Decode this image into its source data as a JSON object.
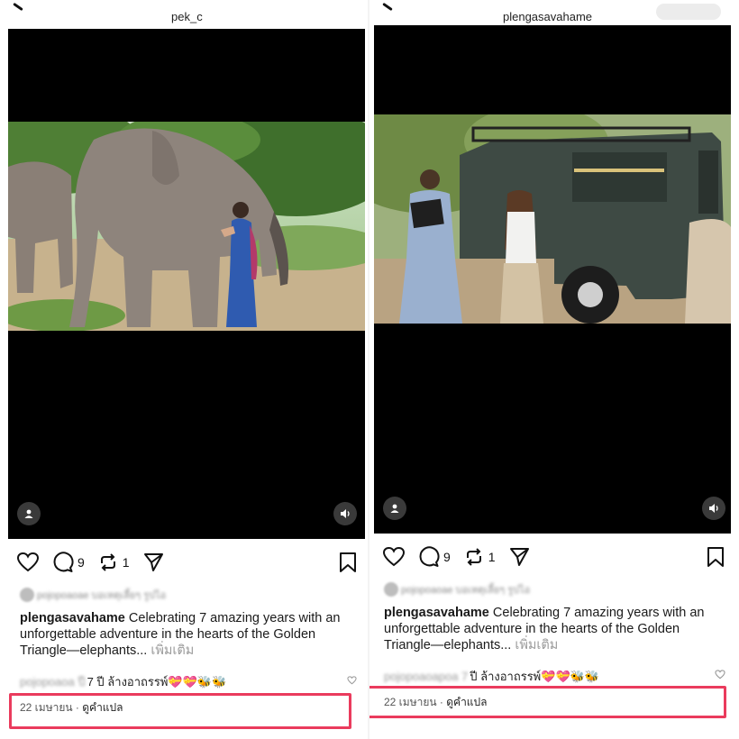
{
  "left_post": {
    "username": "pek_c",
    "likes_blurred": "pojopoaoae บอเหตุเลี้ยๆ รูปไอ",
    "comment_count": "9",
    "repost_count": "1",
    "caption_user": "plengasavahame",
    "caption_text": " Celebrating 7 amazing years with an unforgettable adventure in the hearts of the Golden Triangle—elephants...",
    "see_more": " เพิ่มเติม",
    "comment_blurred": "pojopoaoa ปี",
    "comment_text": "7 ปี ล้างอาถรรพ์💝💝🐝🐝",
    "date": "22 เมษายน",
    "separator": " · ",
    "translate": "ดูคำแปล"
  },
  "right_post": {
    "username": "plengasavahame",
    "likes_blurred": "pojopoaoae บอเหตุเลี้ยๆ รูปไอ",
    "comment_count": "9",
    "repost_count": "1",
    "caption_user": "plengasavahame",
    "caption_text": " Celebrating 7 amazing years with an unforgettable adventure in the hearts of the Golden Triangle—elephants...",
    "see_more": " เพิ่มเติม",
    "comment_blurred": "pojopoaoapoa 7",
    "comment_text": "ปี ล้างอาถรรพ์💝💝🐝🐝",
    "date": "22 เมษายน",
    "separator": " · ",
    "translate": "ดูคำแปล"
  },
  "icons": [
    "back-icon",
    "tag-people-icon",
    "volume-icon",
    "heart-icon",
    "comment-icon",
    "repost-icon",
    "share-icon",
    "bookmark-icon"
  ],
  "colors": {
    "highlight": "#ea3b5d",
    "video_bg": "#000000",
    "muted_text": "#9a9a9a"
  }
}
